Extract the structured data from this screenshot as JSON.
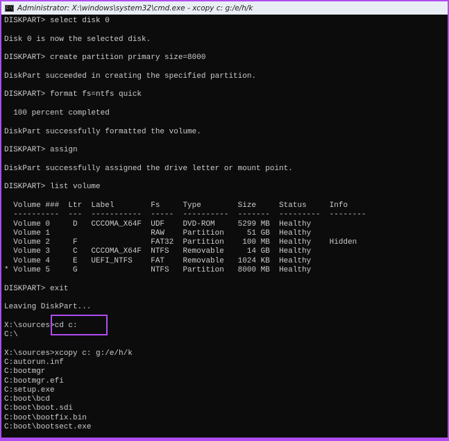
{
  "window": {
    "title": "Administrator: X:\\windows\\system32\\cmd.exe - xcopy  c: g:/e/h/k",
    "icon": "cmd-icon",
    "highlight_color": "#b04cf0"
  },
  "console": {
    "lines": [
      "DISKPART> select disk 0",
      "",
      "Disk 0 is now the selected disk.",
      "",
      "DISKPART> create partition primary size=8000",
      "",
      "DiskPart succeeded in creating the specified partition.",
      "",
      "DISKPART> format fs=ntfs quick",
      "",
      "  100 percent completed",
      "",
      "DiskPart successfully formatted the volume.",
      "",
      "DISKPART> assign",
      "",
      "DiskPart successfully assigned the drive letter or mount point.",
      "",
      "DISKPART> list volume",
      "",
      "  Volume ###  Ltr  Label        Fs     Type        Size     Status     Info",
      "  ----------  ---  -----------  -----  ----------  -------  ---------  --------",
      "  Volume 0     D   CCCOMA_X64F  UDF    DVD-ROM     5299 MB  Healthy",
      "  Volume 1                      RAW    Partition     51 GB  Healthy",
      "  Volume 2     F                FAT32  Partition    100 MB  Healthy    Hidden",
      "  Volume 3     C   CCCOMA_X64F  NTFS   Removable     14 GB  Healthy",
      "  Volume 4     E   UEFI_NTFS    FAT    Removable   1024 KB  Healthy",
      "* Volume 5     G                NTFS   Partition   8000 MB  Healthy",
      "",
      "DISKPART> exit",
      "",
      "Leaving DiskPart...",
      "",
      "X:\\sources>cd c:",
      "C:\\",
      "",
      "X:\\sources>xcopy c: g:/e/h/k",
      "C:autorun.inf",
      "C:bootmgr",
      "C:bootmgr.efi",
      "C:setup.exe",
      "C:boot\\bcd",
      "C:boot\\boot.sdi",
      "C:boot\\bootfix.bin",
      "C:boot\\bootsect.exe"
    ]
  }
}
